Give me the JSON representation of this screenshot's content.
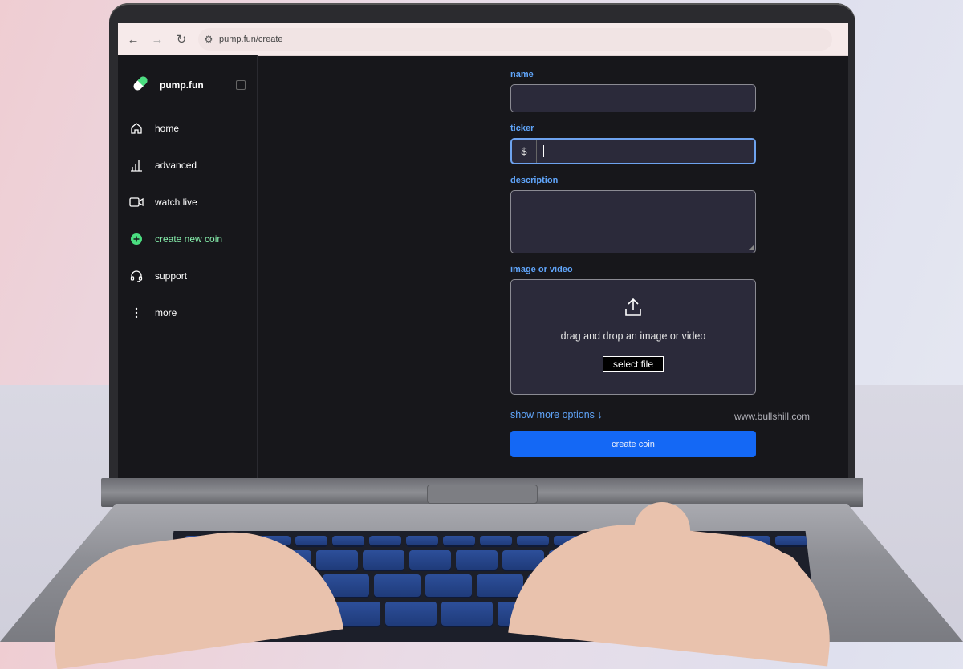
{
  "browser": {
    "back_icon": "arrow-left-icon",
    "forward_icon": "arrow-right-icon",
    "reload_icon": "reload-icon",
    "url": "pump.fun/create"
  },
  "sidebar": {
    "brand": "pump.fun",
    "items": [
      {
        "label": "home",
        "icon": "home-icon"
      },
      {
        "label": "advanced",
        "icon": "chart-bars-icon"
      },
      {
        "label": "watch live",
        "icon": "video-camera-icon"
      },
      {
        "label": "create new coin",
        "icon": "plus-circle-icon"
      },
      {
        "label": "support",
        "icon": "headset-icon"
      },
      {
        "label": "more",
        "icon": "more-vertical-icon"
      }
    ],
    "active_color": "#86efac"
  },
  "form": {
    "name_label": "name",
    "name_value": "",
    "ticker_label": "ticker",
    "ticker_prefix": "$",
    "ticker_value": "",
    "description_label": "description",
    "description_value": "",
    "media_label": "image or video",
    "dropzone_text": "drag and drop an image or video",
    "select_file_label": "select file",
    "show_more_label": "show more options ↓",
    "create_label": "create coin"
  },
  "colors": {
    "accent_blue": "#1468f5",
    "label_blue": "#60a5fa"
  },
  "watermark": "www.bullshill.com"
}
